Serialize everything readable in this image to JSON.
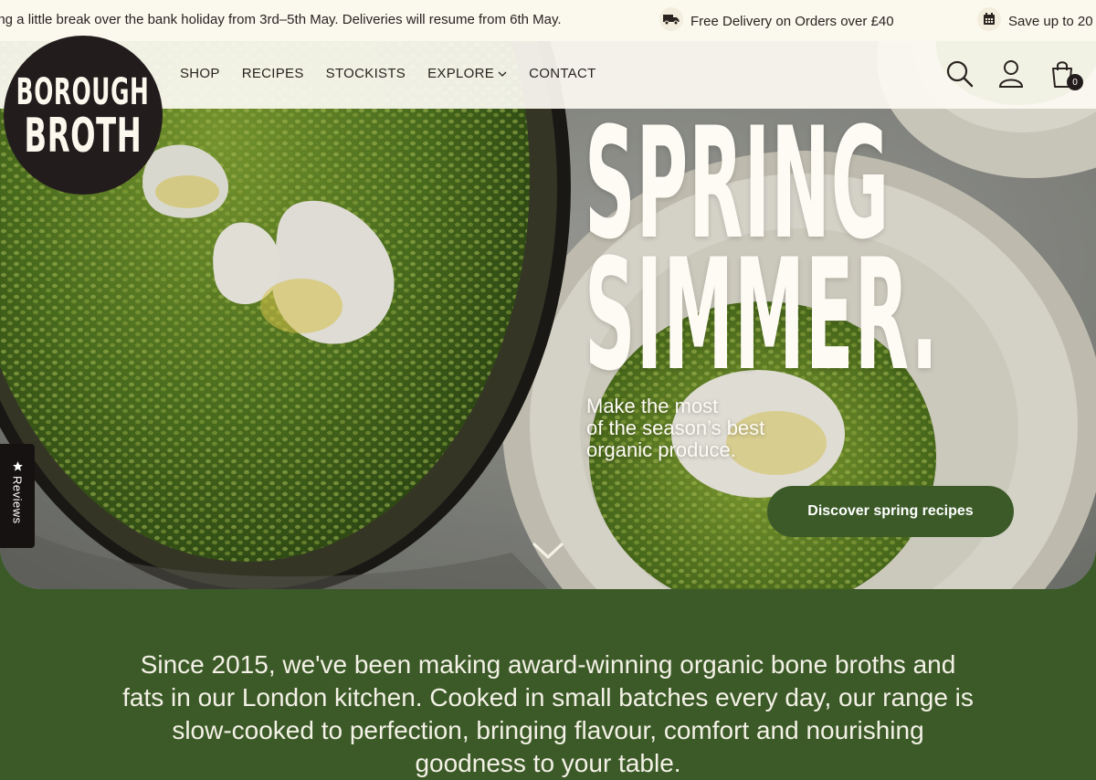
{
  "announcement": {
    "message_1": "ing a little break over the bank holiday from 3rd–5th May. Deliveries will resume from 6th May.",
    "message_2": "Free Delivery on Orders over £40",
    "message_3": "Save up to 20",
    "icons": [
      "truck-icon",
      "calendar-icon"
    ]
  },
  "brand": {
    "line1": "BOROUGH",
    "line2": "BROTH"
  },
  "nav": {
    "items": [
      {
        "label": "SHOP"
      },
      {
        "label": "RECIPES"
      },
      {
        "label": "STOCKISTS"
      },
      {
        "label": "EXPLORE",
        "has_dropdown": true
      },
      {
        "label": "CONTACT"
      }
    ],
    "cart_count": "0",
    "icons": [
      "search-icon",
      "account-icon",
      "cart-icon"
    ]
  },
  "hero": {
    "headline_1": "SPRING",
    "headline_2": "SIMMER.",
    "sub_1": "Make the most",
    "sub_2": "of the season’s best",
    "sub_3": "organic produce.",
    "cta_label": "Discover spring recipes"
  },
  "reviews_tab": {
    "label": "Reviews"
  },
  "intro": {
    "text": "Since 2015, we've been making award-winning organic bone broths and fats in our London kitchen. Cooked in small batches every day, our range is slow-cooked to perfection, bringing flavour, comfort and nourishing goodness to your table."
  },
  "colors": {
    "brand_green": "#3b5a28",
    "cream": "#fbf8ee",
    "dark": "#231c1d"
  }
}
